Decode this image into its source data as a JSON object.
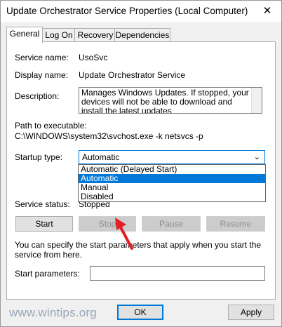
{
  "window": {
    "title": "Update Orchestrator Service Properties (Local Computer)",
    "close_glyph": "✕"
  },
  "tabs": [
    {
      "label": "General",
      "active": true
    },
    {
      "label": "Log On",
      "active": false
    },
    {
      "label": "Recovery",
      "active": false
    },
    {
      "label": "Dependencies",
      "active": false
    }
  ],
  "general": {
    "service_name_label": "Service name:",
    "service_name_value": "UsoSvc",
    "display_name_label": "Display name:",
    "display_name_value": "Update Orchestrator Service",
    "description_label": "Description:",
    "description_value": "Manages Windows Updates. If stopped, your devices will not be able to download and install the latest updates",
    "path_label": "Path to executable:",
    "path_value": "C:\\WINDOWS\\system32\\svchost.exe -k netsvcs -p",
    "startup_type_label": "Startup type:",
    "startup_type_value": "Automatic",
    "startup_options": [
      {
        "label": "Automatic (Delayed Start)",
        "selected": false
      },
      {
        "label": "Automatic",
        "selected": true
      },
      {
        "label": "Manual",
        "selected": false
      },
      {
        "label": "Disabled",
        "selected": false
      }
    ],
    "service_status_label": "Service status:",
    "service_status_value": "Stopped",
    "buttons": {
      "start": {
        "label": "Start",
        "enabled": true
      },
      "stop": {
        "label": "Stop",
        "enabled": false
      },
      "pause": {
        "label": "Pause",
        "enabled": false
      },
      "resume": {
        "label": "Resume",
        "enabled": false
      }
    },
    "start_params_hint": "You can specify the start parameters that apply when you start the service from here.",
    "start_params_label": "Start parameters:",
    "start_params_value": ""
  },
  "footer": {
    "ok_label": "OK",
    "apply_label": "Apply"
  },
  "watermark": "www.wintips.org",
  "colors": {
    "accent": "#0078d7",
    "pointer_arrow": "#e31e24"
  }
}
